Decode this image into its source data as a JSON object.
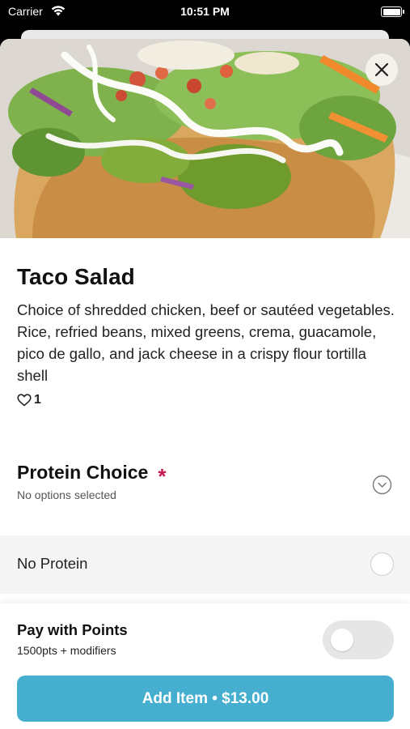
{
  "status_bar": {
    "carrier": "Carrier",
    "time": "10:51 PM",
    "wifi_icon": "wifi-icon",
    "battery_icon": "battery-icon"
  },
  "hero": {
    "image": "taco-salad-photo",
    "close_icon": "close-icon"
  },
  "item": {
    "title": "Taco Salad",
    "description": "Choice of shredded chicken, beef or sautéed vegetables. Rice, refried beans, mixed greens, crema, guacamole, pico de gallo, and jack cheese in a crispy flour tortilla shell",
    "likes_icon": "heart-icon",
    "likes_count": "1"
  },
  "protein_section": {
    "title": "Protein Choice",
    "required_marker": "*",
    "subtitle": "No options selected",
    "chevron_icon": "chevron-down-circle-icon",
    "options": [
      {
        "label": "No Protein",
        "selected": false
      }
    ]
  },
  "footer": {
    "points_title": "Pay with Points",
    "points_subtitle": "1500pts + modifiers",
    "points_toggle_on": false,
    "add_button_label": "Add Item • $13.00"
  },
  "colors": {
    "accent": "#46afd0",
    "required": "#c8174a",
    "option_bg": "#f5f5f5",
    "toggle_off": "#e6e6e6"
  }
}
